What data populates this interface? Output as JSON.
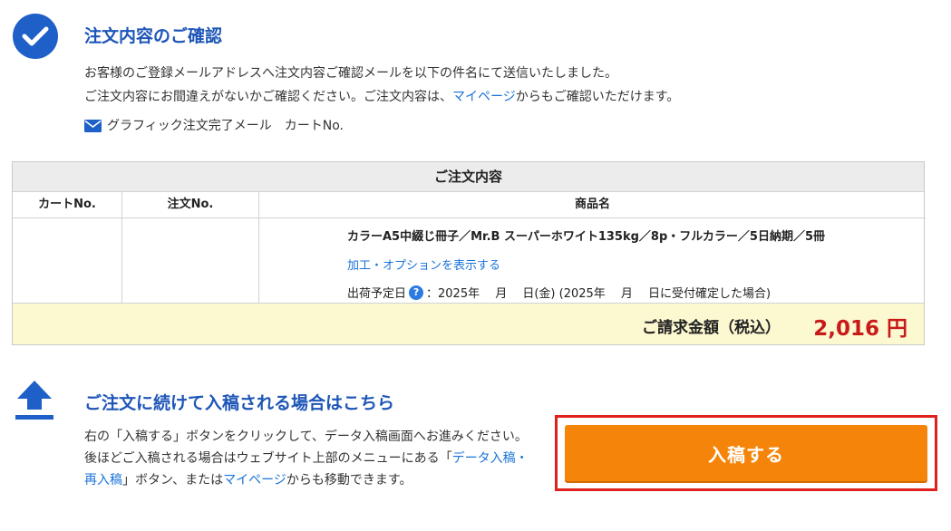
{
  "confirmation": {
    "title": "注文内容のご確認",
    "line1": "お客様のご登録メールアドレスへ注文内容ご確認メールを以下の件名にて送信いたしました。",
    "line2_pre": "ご注文内容にお間違えがないかご確認ください。ご注文内容は、",
    "line2_link": "マイページ",
    "line2_post": "からもご確認いただけます。",
    "mail_subject": "グラフィック注文完了メール　カートNo."
  },
  "order": {
    "heading": "ご注文内容",
    "columns": [
      "カートNo.",
      "注文No.",
      "商品名"
    ],
    "cart_no": "",
    "order_no": "",
    "product_name": "カラーA5中綴じ冊子／Mr.B スーパーホワイト135kg／8p・フルカラー／5日納期／5冊",
    "option_link": "加工・オプションを表示する",
    "ship_label": "出荷予定日",
    "ship_help_icon": "?",
    "ship_value": "：2025年　 月　 日(金) (2025年　 月　 日に受付確定した場合)",
    "total_label": "ご請求金額（税込）",
    "total_amount": "2,016 円"
  },
  "upload": {
    "title": "ご注文に続けて入稿される場合はこちら",
    "text_1": "右の「入稿する」ボタンをクリックして、データ入稿画面へお進みください。後ほどご入稿される場合はウェブサイト上部のメニューにある「",
    "text_link1": "データ入稿・再入稿",
    "text_2": "」ボタン、または",
    "text_link2": "マイページ",
    "text_3": "からも移動できます。",
    "button_label": "入稿する"
  },
  "colors": {
    "accent_blue": "#1f5fc8",
    "link_blue": "#1a73d9",
    "price_red": "#c91a1a",
    "button_orange": "#f5850a",
    "highlight_red": "#e0201c"
  }
}
